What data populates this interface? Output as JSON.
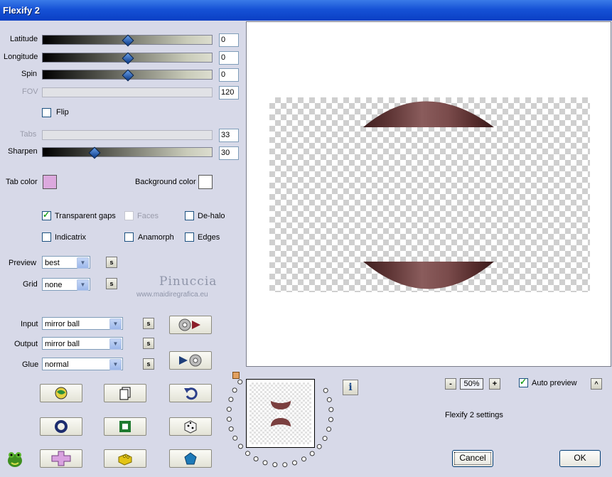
{
  "window": {
    "title": "Flexify 2"
  },
  "sliders": [
    {
      "label": "Latitude",
      "value": "0",
      "enabled": true,
      "level": 0.5
    },
    {
      "label": "Longitude",
      "value": "0",
      "enabled": true,
      "level": 0.5
    },
    {
      "label": "Spin",
      "value": "0",
      "enabled": true,
      "level": 0.5
    },
    {
      "label": "FOV",
      "value": "120",
      "enabled": false
    },
    {
      "label": "Tabs",
      "value": "33",
      "enabled": false
    },
    {
      "label": "Sharpen",
      "value": "30",
      "enabled": true,
      "level": 0.3
    }
  ],
  "flip": {
    "label": "Flip",
    "checked": false
  },
  "colors": {
    "tab_label": "Tab color",
    "tab_value": "#dca9de",
    "bg_label": "Background color",
    "bg_value": "#ffffff"
  },
  "checkboxes": {
    "transparent_gaps": {
      "label": "Transparent gaps",
      "checked": true
    },
    "faces": {
      "label": "Faces",
      "checked": false,
      "enabled": false
    },
    "dehalo": {
      "label": "De-halo",
      "checked": false
    },
    "indicatrix": {
      "label": "Indicatrix",
      "checked": false
    },
    "anamorph": {
      "label": "Anamorph",
      "checked": false
    },
    "edges": {
      "label": "Edges",
      "checked": false
    }
  },
  "selects": {
    "preview": {
      "label": "Preview",
      "value": "best"
    },
    "grid": {
      "label": "Grid",
      "value": "none"
    },
    "input": {
      "label": "Input",
      "value": "mirror ball"
    },
    "output": {
      "label": "Output",
      "value": "mirror ball"
    },
    "glue": {
      "label": "Glue",
      "value": "normal"
    }
  },
  "small_button_label": "s",
  "watermark": {
    "line1": "Pinuccia",
    "line2": "www.maidiregrafica.eu"
  },
  "zoom": {
    "value": "50%",
    "minus": "-",
    "plus": "+"
  },
  "auto_preview": {
    "label": "Auto preview",
    "checked": true,
    "caret": "^"
  },
  "settings_label": "Flexify 2 settings",
  "buttons": {
    "cancel": "Cancel",
    "ok": "OK"
  },
  "info_icon": "i",
  "accent": {
    "titlebar": "#0a3fc4",
    "check": "#21a121",
    "thumb": "#0a3a8a"
  }
}
